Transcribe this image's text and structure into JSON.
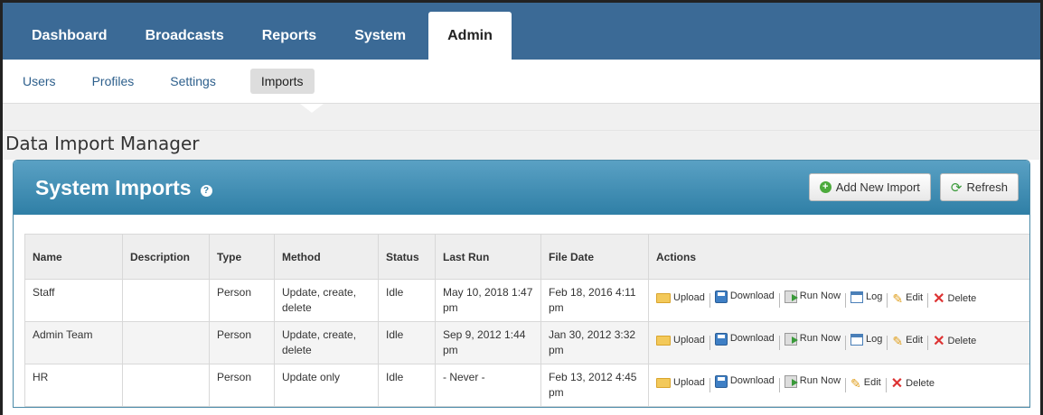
{
  "topnav": {
    "tabs": [
      {
        "label": "Dashboard"
      },
      {
        "label": "Broadcasts"
      },
      {
        "label": "Reports"
      },
      {
        "label": "System"
      },
      {
        "label": "Admin",
        "active": true
      }
    ]
  },
  "subnav": {
    "items": [
      {
        "label": "Users"
      },
      {
        "label": "Profiles"
      },
      {
        "label": "Settings"
      },
      {
        "label": "Imports",
        "active": true
      }
    ]
  },
  "page": {
    "title": "Data Import Manager"
  },
  "panel": {
    "title": "System Imports",
    "help_icon": "?",
    "add_button": "Add New Import",
    "refresh_button": "Refresh"
  },
  "table": {
    "headers": [
      "Name",
      "Description",
      "Type",
      "Method",
      "Status",
      "Last Run",
      "File Date",
      "Actions"
    ],
    "rows": [
      {
        "name": "Staff",
        "description": "",
        "type": "Person",
        "method": "Update, create, delete",
        "status": "Idle",
        "last_run": "May 10, 2018 1:47 pm",
        "file_date": "Feb 18, 2016 4:11 pm",
        "actions": [
          "Upload",
          "Download",
          "Run Now",
          "Log",
          "Edit",
          "Delete"
        ]
      },
      {
        "name": "Admin Team",
        "description": "",
        "type": "Person",
        "method": "Update, create, delete",
        "status": "Idle",
        "last_run": "Sep 9, 2012 1:44 pm",
        "file_date": "Jan 30, 2012 3:32 pm",
        "actions": [
          "Upload",
          "Download",
          "Run Now",
          "Log",
          "Edit",
          "Delete"
        ]
      },
      {
        "name": "HR",
        "description": "",
        "type": "Person",
        "method": "Update only",
        "status": "Idle",
        "last_run": "- Never -",
        "file_date": "Feb 13, 2012 4:45 pm",
        "actions": [
          "Upload",
          "Download",
          "Run Now",
          "Edit",
          "Delete"
        ]
      }
    ]
  },
  "colors": {
    "topnav_bg": "#3b6a96",
    "panel_header": "#2f7fa6",
    "link": "#2d5f8c"
  }
}
